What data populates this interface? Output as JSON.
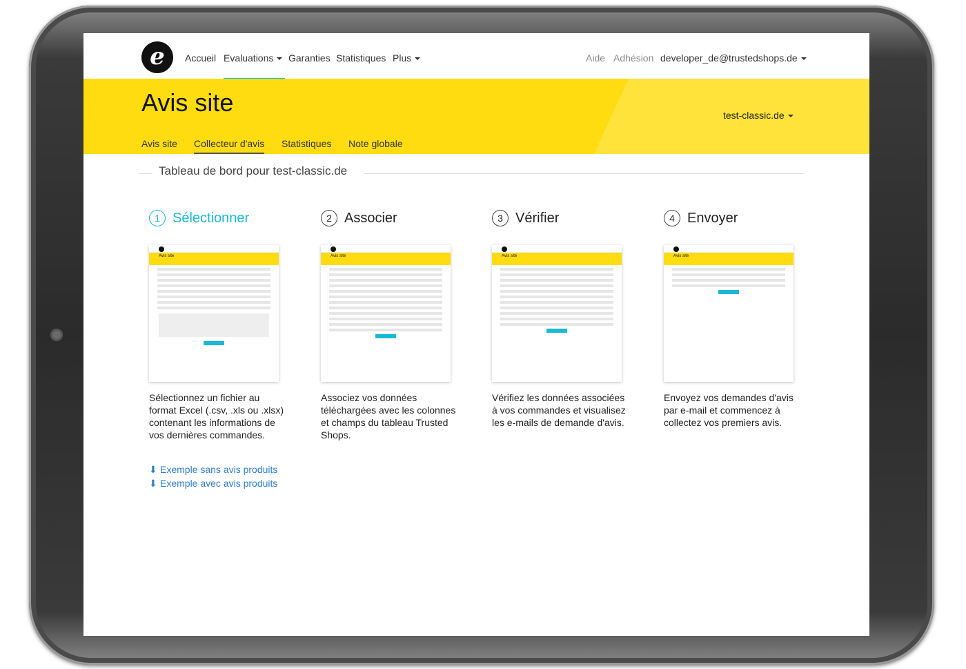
{
  "nav": {
    "items": [
      {
        "label": "Accueil"
      },
      {
        "label": "Evaluations"
      },
      {
        "label": "Garanties"
      },
      {
        "label": "Statistiques"
      },
      {
        "label": "Plus"
      }
    ],
    "help": "Aide",
    "membership": "Adhésion",
    "user": "developer_de@trustedshops.de"
  },
  "hero": {
    "title": "Avis site",
    "shop": "test-classic.de",
    "tabs": [
      {
        "label": "Avis site"
      },
      {
        "label": "Collecteur d'avis"
      },
      {
        "label": "Statistiques"
      },
      {
        "label": "Note globale"
      }
    ]
  },
  "dashboard_title": "Tableau de bord pour test-classic.de",
  "steps": [
    {
      "num": "1",
      "title": "Sélectionner",
      "desc": "Sélectionnez un fichier au format Excel (.csv, .xls ou .xlsx) contenant les informations de vos dernières commandes."
    },
    {
      "num": "2",
      "title": "Associer",
      "desc": "Associez vos données téléchargées avec les colonnes et champs du tableau Trusted Shops."
    },
    {
      "num": "3",
      "title": "Vérifier",
      "desc": "Vérifiez les données associées à vos commandes et visualisez les e-mails de demande d'avis."
    },
    {
      "num": "4",
      "title": "Envoyer",
      "desc": "Envoyez vos demandes d'avis par e-mail et commencez à collectez vos premiers avis."
    }
  ],
  "thumbs": {
    "title": "Avis site"
  },
  "downloads": [
    {
      "label": "Exemple sans avis produits"
    },
    {
      "label": "Exemple avec avis produits"
    }
  ],
  "colors": {
    "accent": "#1ab9d7",
    "brand_yellow": "#ffdc0f",
    "link": "#2f7ecb"
  }
}
